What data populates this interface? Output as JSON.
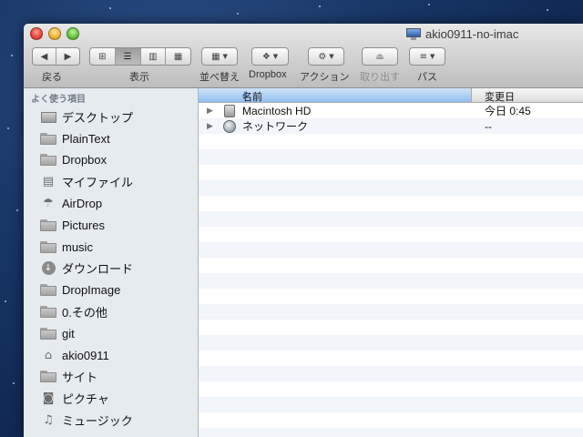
{
  "window": {
    "title": "akio0911-no-imac",
    "title_icon": "imac-icon"
  },
  "toolbar": {
    "back_label": "戻る",
    "view_label": "表示",
    "arrange_label": "並べ替え",
    "dropbox_label": "Dropbox",
    "action_label": "アクション",
    "eject_label": "取り出す",
    "path_label": "パス",
    "view_active": "list"
  },
  "sidebar": {
    "header": "よく使う項目",
    "items": [
      {
        "label": "デスクトップ",
        "icon": "desktop-icon"
      },
      {
        "label": "PlainText",
        "icon": "folder-icon"
      },
      {
        "label": "Dropbox",
        "icon": "folder-icon"
      },
      {
        "label": "マイファイル",
        "icon": "all-my-files-icon"
      },
      {
        "label": "AirDrop",
        "icon": "airdrop-icon"
      },
      {
        "label": "Pictures",
        "icon": "folder-icon"
      },
      {
        "label": "music",
        "icon": "folder-icon"
      },
      {
        "label": "ダウンロード",
        "icon": "downloads-icon"
      },
      {
        "label": "DropImage",
        "icon": "folder-icon"
      },
      {
        "label": "0.その他",
        "icon": "folder-icon"
      },
      {
        "label": "git",
        "icon": "folder-icon"
      },
      {
        "label": "akio0911",
        "icon": "home-icon"
      },
      {
        "label": "サイト",
        "icon": "folder-icon"
      },
      {
        "label": "ピクチャ",
        "icon": "camera-icon"
      },
      {
        "label": "ミュージック",
        "icon": "music-note-icon"
      }
    ]
  },
  "columns": {
    "name": "名前",
    "date": "変更日",
    "sort": "ascending"
  },
  "files": [
    {
      "name": "Macintosh HD",
      "date": "今日 0:45",
      "icon": "hard-disk-icon"
    },
    {
      "name": "ネットワーク",
      "date": "--",
      "icon": "network-icon"
    }
  ]
}
